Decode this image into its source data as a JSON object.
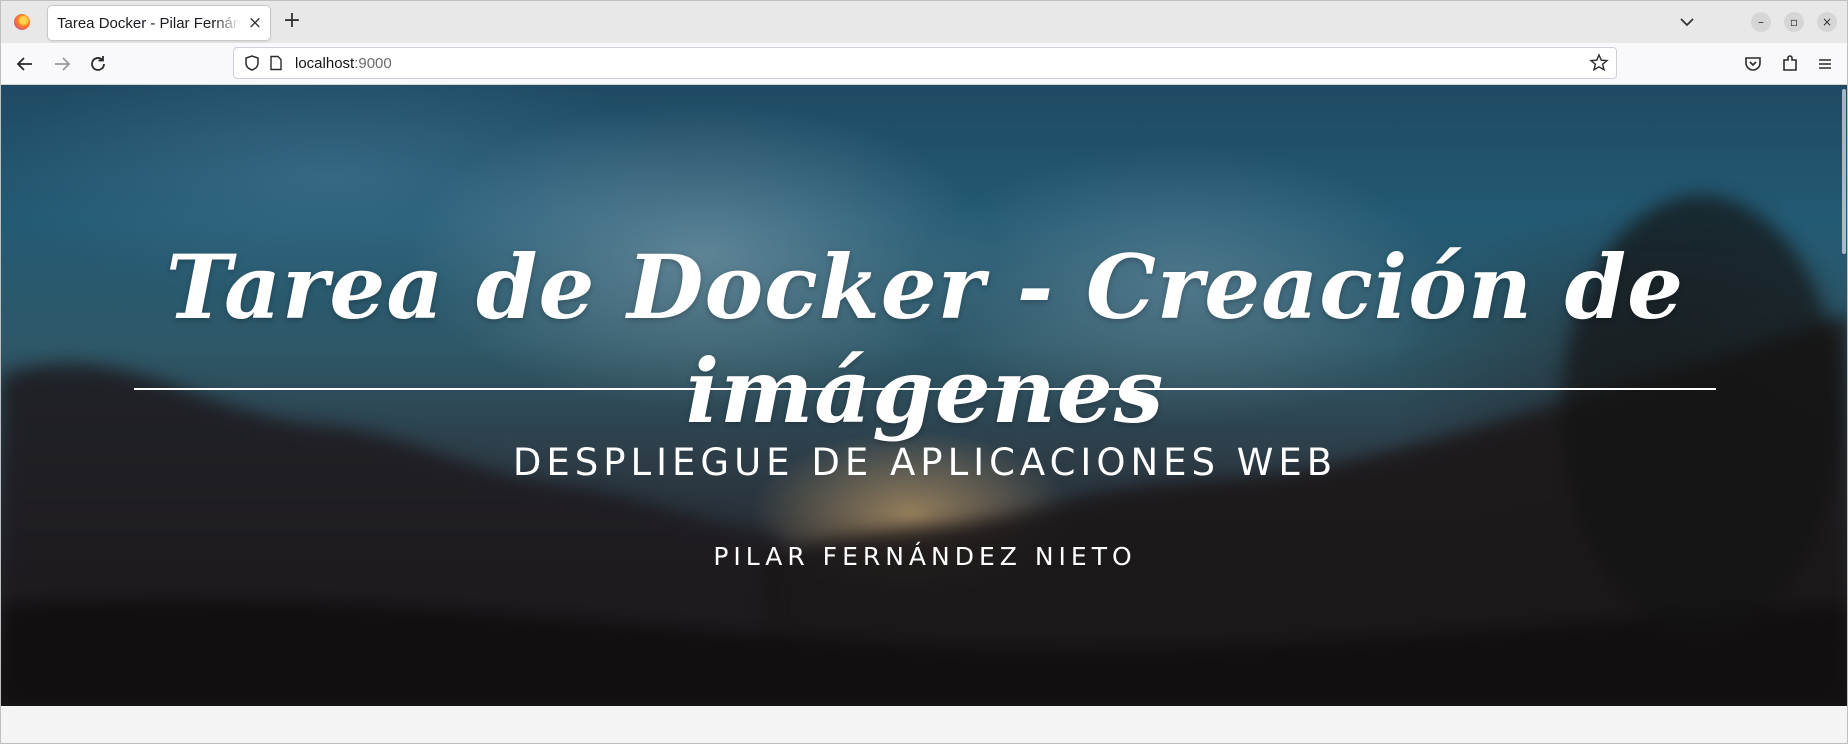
{
  "browser": {
    "tab": {
      "title": "Tarea Docker - Pilar Fernández Nieto",
      "close_label": "×"
    },
    "new_tab_label": "+",
    "url": {
      "host": "localhost",
      "port": ":9000"
    },
    "window_controls": {
      "minimize": "–",
      "restore": "▫",
      "close": "×"
    }
  },
  "hero": {
    "title": "Tarea de Docker - Creación de imágenes",
    "subtitle": "DESPLIEGUE DE APLICACIONES WEB",
    "author": "PILAR FERNÁNDEZ NIETO"
  },
  "colors": {
    "hero_text": "#ffffff",
    "page_background": "#f4f4f4",
    "tabbar": "#e8e8e8"
  }
}
